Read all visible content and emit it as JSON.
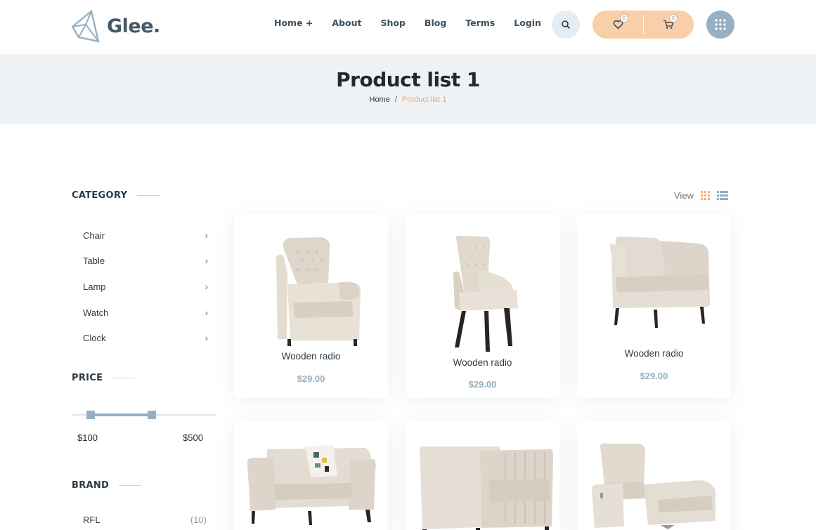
{
  "brand": {
    "name": "Glee."
  },
  "nav": {
    "items": [
      "Home +",
      "About",
      "Shop",
      "Blog",
      "Terms",
      "Login"
    ]
  },
  "header_actions": {
    "wishlist_count": "0",
    "cart_count": "0"
  },
  "banner": {
    "title": "Product list 1",
    "breadcrumb": {
      "home": "Home",
      "separator": "/",
      "current": "Product list 1"
    }
  },
  "sidebar": {
    "category_title": "CATEGORY",
    "categories": [
      "Chair",
      "Table",
      "Lamp",
      "Watch",
      "Clock"
    ],
    "price_title": "PRICE",
    "price_min": "$100",
    "price_max": "$500",
    "brand_title": "BRAND",
    "brands": [
      {
        "name": "RFL",
        "count": "(10)"
      }
    ]
  },
  "view": {
    "label": "View"
  },
  "products": [
    {
      "name": "Wooden radio",
      "price": "$29.00"
    },
    {
      "name": "Wooden radio",
      "price": "$29.00"
    },
    {
      "name": "Wooden radio",
      "price": "$29.00"
    },
    {
      "name": "",
      "price": ""
    },
    {
      "name": "",
      "price": ""
    },
    {
      "name": "",
      "price": ""
    }
  ],
  "colors": {
    "accent": "#f8cfa9",
    "accent_text": "#f3a36a",
    "steel": "#97afc0",
    "banner_bg": "#eef2f5",
    "chair": "#e4dcd1"
  }
}
